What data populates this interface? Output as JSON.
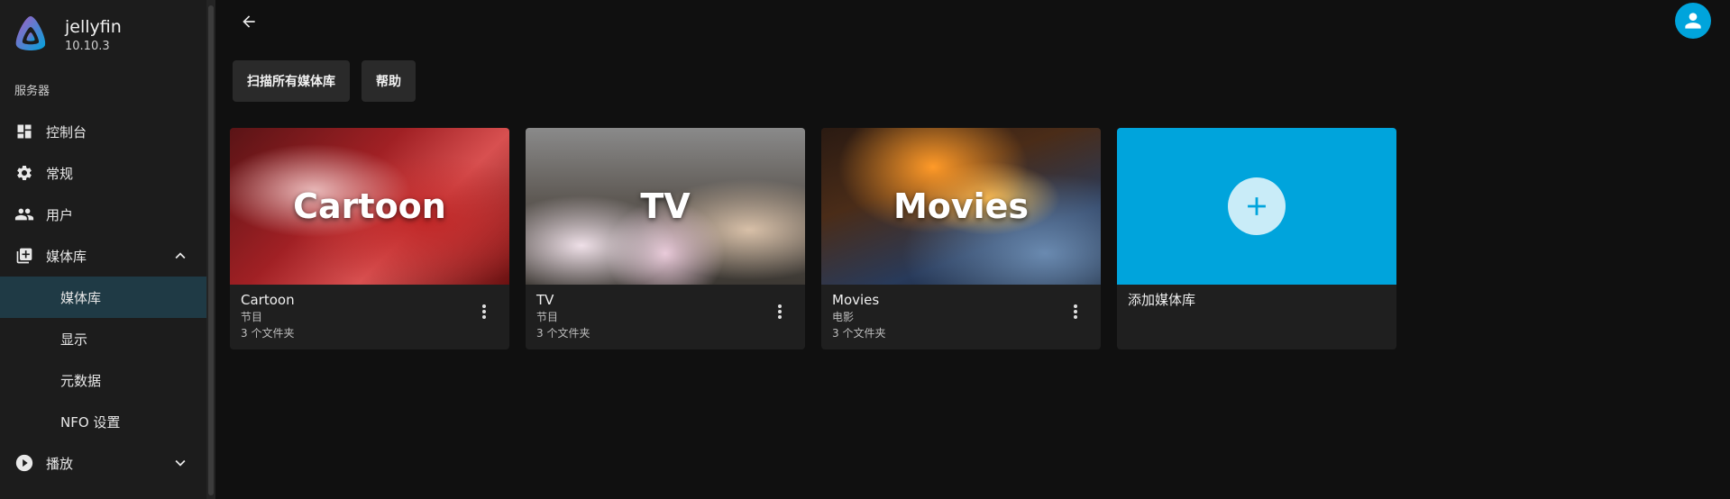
{
  "sidebar": {
    "app_name": "jellyfin",
    "version": "10.10.3",
    "section_title": "服务器",
    "items": [
      {
        "label": "控制台",
        "icon": "dashboard-icon"
      },
      {
        "label": "常规",
        "icon": "gear-icon"
      },
      {
        "label": "用户",
        "icon": "users-icon"
      },
      {
        "label": "媒体库",
        "icon": "library-add-icon",
        "expanded": true
      }
    ],
    "sub_items": [
      {
        "label": "媒体库",
        "active": true
      },
      {
        "label": "显示",
        "active": false
      },
      {
        "label": "元数据",
        "active": false
      },
      {
        "label": "NFO 设置",
        "active": false
      }
    ],
    "playback": {
      "label": "播放",
      "icon": "play-circle-icon",
      "expanded": false
    }
  },
  "header": {
    "back_icon": "arrow-left-icon",
    "avatar_icon": "user-icon"
  },
  "toolbar": {
    "scan_label": "扫描所有媒体库",
    "help_label": "帮助"
  },
  "libraries": [
    {
      "overlay": "Cartoon",
      "name": "Cartoon",
      "type": "节目",
      "count": "3 个文件夹"
    },
    {
      "overlay": "TV",
      "name": "TV",
      "type": "节目",
      "count": "3 个文件夹"
    },
    {
      "overlay": "Movies",
      "name": "Movies",
      "type": "电影",
      "count": "3 个文件夹"
    }
  ],
  "add_library": {
    "label": "添加媒体库",
    "icon": "plus-icon"
  },
  "colors": {
    "accent": "#00a4dc",
    "sidebar_bg": "#1c1c1c",
    "active_bg": "#1f3a45",
    "page_bg": "#101010"
  }
}
